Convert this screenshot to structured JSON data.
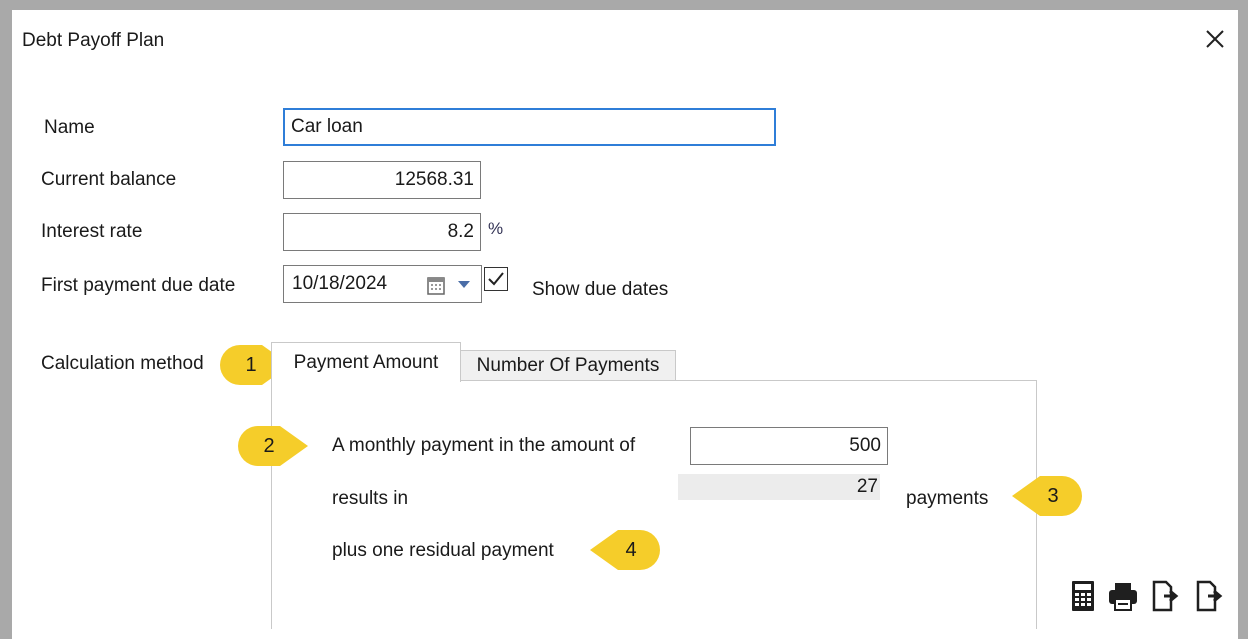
{
  "window": {
    "title": "Debt Payoff Plan"
  },
  "form": {
    "name_label": "Name",
    "name_value": "Car loan",
    "balance_label": "Current balance",
    "balance_value": "12568.31",
    "rate_label": "Interest rate",
    "rate_value": "8.2",
    "rate_unit": "%",
    "due_label": "First payment due date",
    "due_value": "10/18/2024",
    "show_due_label": "Show due dates",
    "show_due_checked": true,
    "method_label": "Calculation method"
  },
  "tabs": [
    {
      "label": "Payment Amount",
      "active": true
    },
    {
      "label": "Number Of Payments",
      "active": false
    }
  ],
  "panel": {
    "payment_label": "A monthly payment in the amount of",
    "payment_value": "500",
    "results_label": "results in",
    "payments_count": "27",
    "payments_unit": "payments",
    "residual_label": "plus one residual payment"
  },
  "callouts": [
    "1",
    "2",
    "3",
    "4"
  ],
  "icons": [
    "close-icon",
    "calendar-icon",
    "calculator-icon",
    "print-icon",
    "export-icon",
    "export-icon"
  ],
  "colors": {
    "callout": "#f5cd2a",
    "focus_border": "#2f7ed8",
    "readonly_bg": "#ececec"
  }
}
